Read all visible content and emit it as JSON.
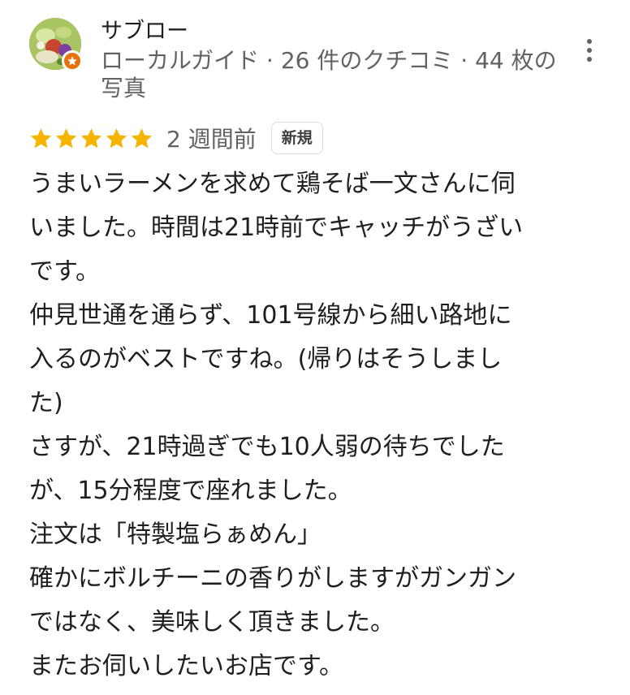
{
  "reviewer": {
    "name": "サブロー",
    "meta": "ローカルガイド · 26 件のクチコミ · 44 枚の写真"
  },
  "review": {
    "rating": 5,
    "max_rating": 5,
    "date": "2 週間前",
    "badge": "新規",
    "lines": [
      "うまいラーメンを求めて鶏そば一文さんに伺",
      "いました。時間は21時前でキャッチがうざい",
      "です。",
      "仲見世通を通らず、101号線から細い路地に",
      "入るのがベストですね。(帰りはそうしまし",
      "た)",
      "さすが、21時過ぎでも10人弱の待ちでした",
      "が、15分程度で座れました。",
      "注文は「特製塩らぁめん」",
      "確かにボルチーニの香りがしますがガンガン",
      "ではなく、美味しく頂きました。",
      "またお伺いしたいお店です。"
    ]
  },
  "colors": {
    "star": "#f6b400",
    "meta_text": "#5f6368",
    "guide_badge": "#e8710a"
  },
  "icons": {
    "more": "vertical-ellipsis-icon",
    "badge": "local-guide-star-icon",
    "rating": "star-icon"
  }
}
